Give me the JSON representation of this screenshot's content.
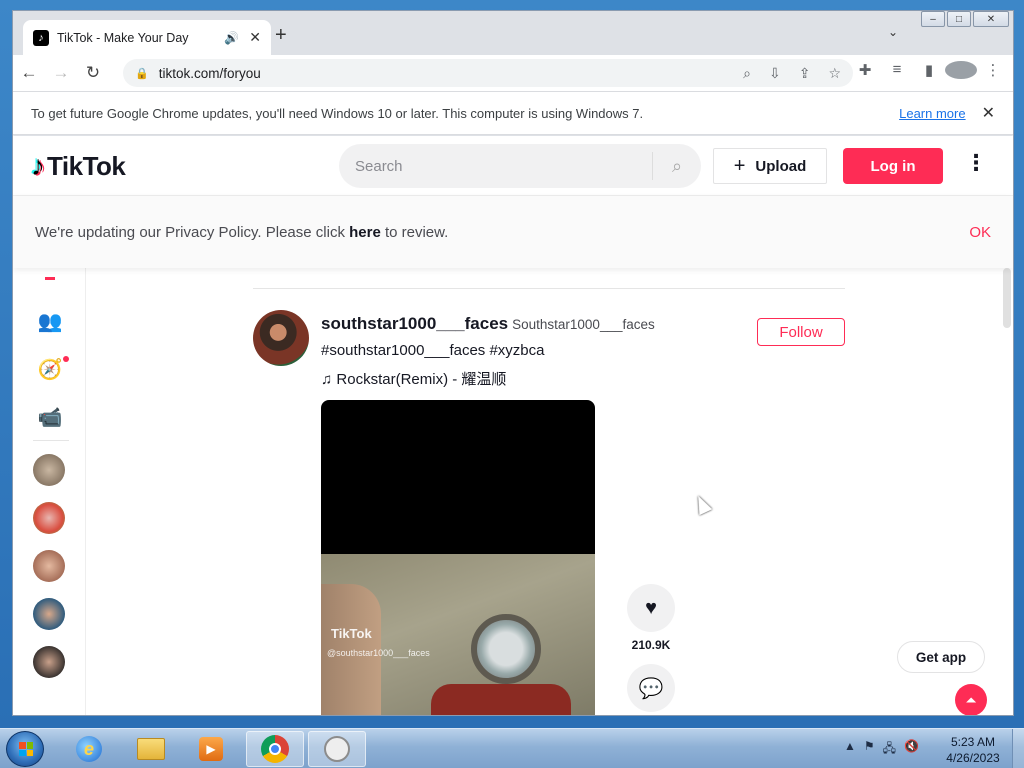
{
  "browser": {
    "tab_title": "TikTok - Make Your Day",
    "url": "tiktok.com/foryou",
    "infobar_message": "To get future Google Chrome updates, you'll need Windows 10 or later. This computer is using Windows 7.",
    "infobar_link": "Learn more"
  },
  "tiktok": {
    "logo_text": "TikTok",
    "search_placeholder": "Search",
    "upload_label": "Upload",
    "login_label": "Log in",
    "privacy_prefix": "We're updating our Privacy Policy. Please click ",
    "privacy_link": "here",
    "privacy_suffix": " to review.",
    "privacy_ok": "OK",
    "post": {
      "username": "southstar1000___faces",
      "nickname": "Southstar1000___faces",
      "hashtags": "#southstar1000___faces #xyzbca",
      "music": "Rockstar(Remix) - 耀温顺",
      "follow_label": "Follow",
      "likes": "210.9K",
      "watermark_logo": "TikTok",
      "watermark_user": "@southstar1000___faces"
    },
    "get_app_label": "Get app"
  },
  "taskbar": {
    "time": "5:23 AM",
    "date": "4/26/2023"
  },
  "colors": {
    "brand": "#fe2c55",
    "link": "#1a73e8"
  },
  "icons": [
    "sound-icon",
    "lock-icon",
    "search-icon",
    "install-icon",
    "share-icon",
    "star-icon",
    "extensions-icon",
    "media-icon",
    "sidepanel-icon",
    "profile-icon",
    "menu-icon",
    "following-icon",
    "explore-icon",
    "live-icon",
    "heart-icon",
    "comment-icon",
    "back-to-top-icon"
  ]
}
